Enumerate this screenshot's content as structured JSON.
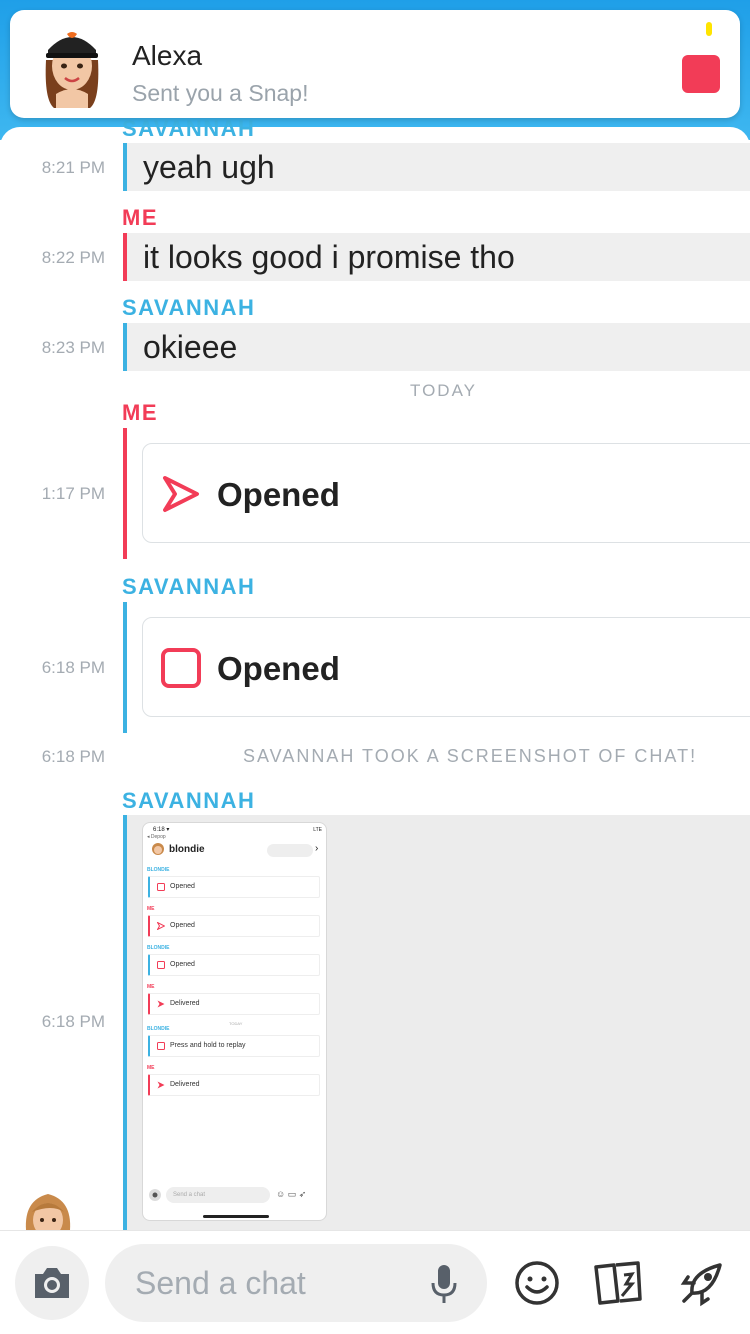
{
  "notification": {
    "name": "Alexa",
    "subtitle": "Sent you a Snap!",
    "snap_color": "#f23c57"
  },
  "colors": {
    "me": "#f23c57",
    "friend": "#3cb2e2",
    "header": "#1f9fe8"
  },
  "messages": [
    {
      "sender": "SAVANNAH",
      "time": "8:21 PM",
      "text": "yeah ugh"
    },
    {
      "sender": "ME",
      "time": "8:22 PM",
      "text": "it looks good i promise tho"
    },
    {
      "sender": "SAVANNAH",
      "time": "8:23 PM",
      "text": "okieee"
    }
  ],
  "day_separator": "TODAY",
  "snaps": [
    {
      "sender": "ME",
      "time": "1:17 PM",
      "label": "Opened",
      "icon": "opened-arrow-icon"
    },
    {
      "sender": "SAVANNAH",
      "time": "6:18 PM",
      "label": "Opened",
      "icon": "opened-square-icon"
    }
  ],
  "system": {
    "time": "6:18 PM",
    "text": "SAVANNAH TOOK A SCREENSHOT OF CHAT!"
  },
  "media": {
    "sender": "SAVANNAH",
    "time": "6:18 PM",
    "thumb": {
      "status_time": "6:18 ▾",
      "signal": "LTE",
      "back": "◂ Depop",
      "name": "blondie",
      "rows": [
        {
          "sender": "BLONDIE",
          "text": "Opened",
          "type": "friend"
        },
        {
          "sender": "ME",
          "text": "Opened",
          "type": "me"
        },
        {
          "sender": "BLONDIE",
          "text": "Opened",
          "type": "friend"
        },
        {
          "sender": "ME",
          "text": "Delivered",
          "type": "me"
        },
        {
          "sender": "BLONDIE",
          "text": "Press and hold to replay",
          "type": "friend"
        },
        {
          "sender": "ME",
          "text": "Delivered",
          "type": "me"
        }
      ],
      "today": "TODAY",
      "input_placeholder": "Send a chat"
    }
  },
  "composer": {
    "placeholder": "Send a chat"
  }
}
